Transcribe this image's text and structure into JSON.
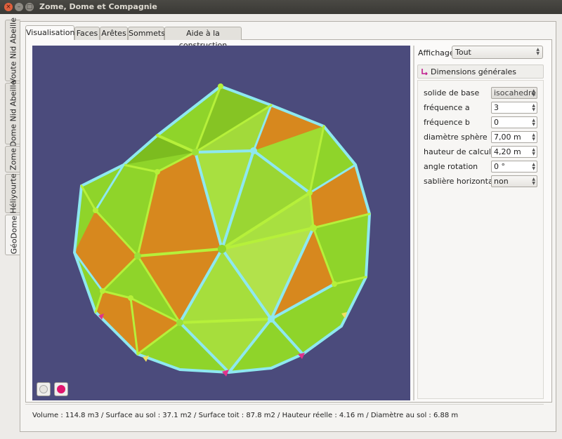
{
  "window": {
    "title": "Zome, Dome et Compagnie"
  },
  "vertical_tabs": [
    {
      "label": "Voute Nid Abeille",
      "active": false
    },
    {
      "label": "Dome Nid Abeille",
      "active": false
    },
    {
      "label": "Zome",
      "active": false
    },
    {
      "label": "Héliyourte",
      "active": false
    },
    {
      "label": "GéoDome",
      "active": true
    }
  ],
  "tabs": [
    {
      "label": "Visualisation",
      "active": true
    },
    {
      "label": "Faces",
      "active": false
    },
    {
      "label": "Arêtes",
      "active": false
    },
    {
      "label": "Sommets",
      "active": false
    },
    {
      "label": "Aide à la construction",
      "active": false
    }
  ],
  "panel": {
    "affichage_label": "Affichage",
    "affichage_value": "Tout",
    "section_title": "Dimensions générales",
    "fields": [
      {
        "label": "solide de base",
        "value": "isocahedre",
        "kind": "combo-disabled"
      },
      {
        "label": "fréquence a",
        "value": "3",
        "kind": "spin"
      },
      {
        "label": "fréquence b",
        "value": "0",
        "kind": "spin"
      },
      {
        "label": "diamètre sphère",
        "value": "7,00 m",
        "kind": "spin"
      },
      {
        "label": "hauteur de calcul",
        "value": "4,20 m",
        "kind": "spin"
      },
      {
        "label": "angle rotation",
        "value": "0 °",
        "kind": "spin"
      },
      {
        "label": "sablière horizontale",
        "value": "non",
        "kind": "combo"
      }
    ]
  },
  "status": {
    "text": "Volume :  114.8 m3   / Surface au sol :  37.1 m2   / Surface toit :  87.8 m2   / Hauteur réelle :  4.16 m   / Diamètre au sol :  6.88 m"
  },
  "colors": {
    "viewport_bg": "#4b4b7c",
    "face_green": "#8fd42a",
    "face_orange": "#d7881e",
    "edge_cyan": "#8ee8f0",
    "edge_green": "#b6f03a",
    "node_pink": "#e0338c"
  },
  "icons": {
    "view_button_1": "wireframe-sphere-icon",
    "view_button_2": "color-dot-icon",
    "section_icon": "expand-arrow-icon"
  }
}
